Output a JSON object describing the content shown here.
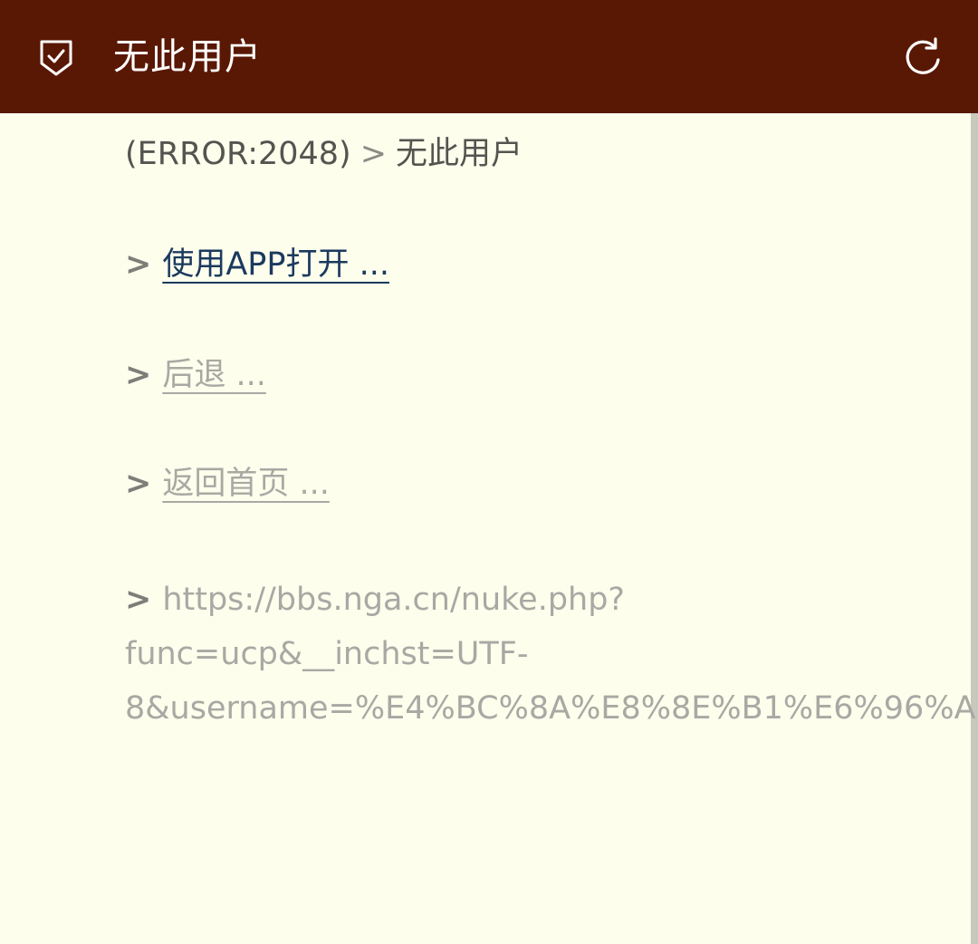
{
  "header": {
    "title": "无此用户",
    "shield_icon": "shield-check-icon",
    "refresh_icon": "refresh-icon",
    "background_color": "#591804"
  },
  "error": {
    "code_text": "(ERROR:2048)",
    "arrow": ">",
    "message": "无此用户"
  },
  "links": {
    "prefix": ">",
    "open_app": "使用APP打开 ...",
    "back": "后退 ...",
    "home": "返回首页 ..."
  },
  "url": {
    "prefix": ">",
    "line1": "https://bbs.nga.cn/nuke.php?",
    "line2": "func=ucp&__inchst=UTF-",
    "line3": "8&username=%E4%BC%8A%E8%8E%B1%E6%96%A"
  }
}
